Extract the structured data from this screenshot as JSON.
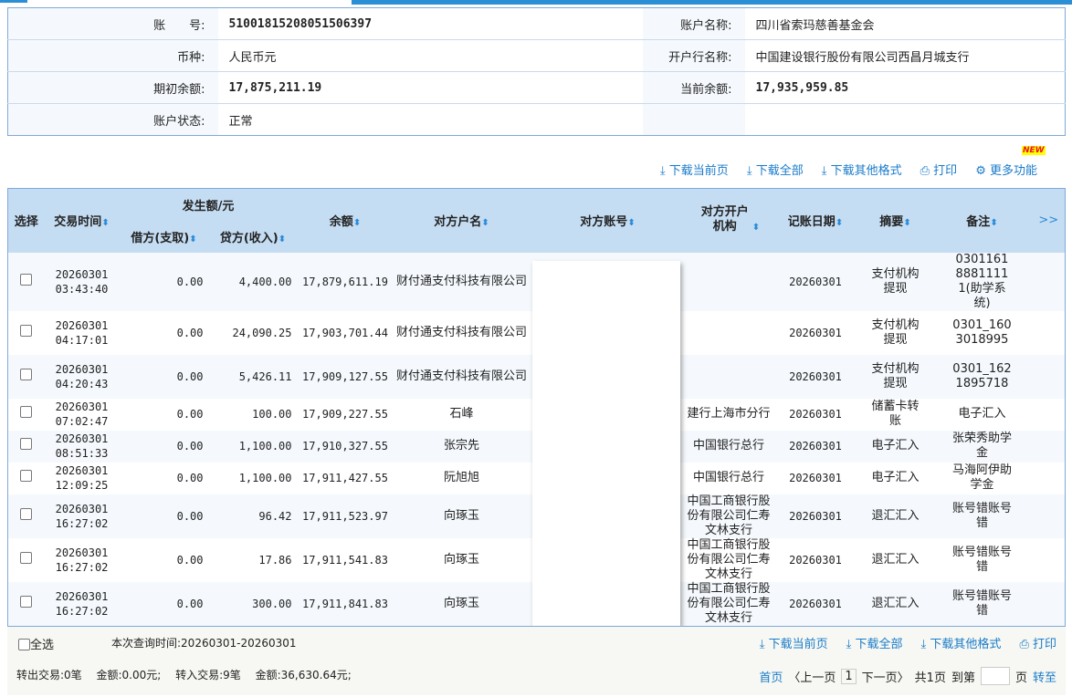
{
  "account": {
    "no_label": "账　　号:",
    "no": "51001815208051506397",
    "name_label": "账户名称:",
    "name": "四川省索玛慈善基金会",
    "currency_label": "币种:",
    "currency": "人民币元",
    "bank_label": "开户行名称:",
    "bank": "中国建设银行股份有限公司西昌月城支行",
    "open_label": "期初余额:",
    "open": "17,875,211.19",
    "cur_label": "当前余额:",
    "cur": "17,935,959.85",
    "status_label": "账户状态:",
    "status": "正常"
  },
  "toolbar": {
    "new_badge": "NEW",
    "dl_page": "下载当前页",
    "dl_all": "下载全部",
    "dl_other": "下载其他格式",
    "print": "打印",
    "more": "更多功能"
  },
  "table": {
    "headers": {
      "select": "选择",
      "time": "交易时间",
      "amount": "发生额/元",
      "debit": "借方(支取)",
      "credit": "贷方(收入)",
      "balance": "余额",
      "cp_name": "对方户名",
      "cp_acct": "对方账号",
      "cp_bank": "对方开户机构",
      "book_date": "记账日期",
      "summary": "摘要",
      "remark": "备注",
      "more": ">>"
    },
    "rows": [
      {
        "date": "20260301",
        "time": "03:43:40",
        "debit": "0.00",
        "credit": "4,400.00",
        "balance": "17,879,611.19",
        "name": "财付通支付科技有限公司",
        "bank": "",
        "book": "20260301",
        "summary": "支付机构提现",
        "remark": "030116188811111(助学系统)"
      },
      {
        "date": "20260301",
        "time": "04:17:01",
        "debit": "0.00",
        "credit": "24,090.25",
        "balance": "17,903,701.44",
        "name": "财付通支付科技有限公司",
        "bank": "",
        "book": "20260301",
        "summary": "支付机构提现",
        "remark": "0301_1603018995"
      },
      {
        "date": "20260301",
        "time": "04:20:43",
        "debit": "0.00",
        "credit": "5,426.11",
        "balance": "17,909,127.55",
        "name": "财付通支付科技有限公司",
        "bank": "",
        "book": "20260301",
        "summary": "支付机构提现",
        "remark": "0301_1621895718"
      },
      {
        "date": "20260301",
        "time": "07:02:47",
        "debit": "0.00",
        "credit": "100.00",
        "balance": "17,909,227.55",
        "name": "石峰",
        "bank": "建行上海市分行",
        "book": "20260301",
        "summary": "储蓄卡转账",
        "remark": "电子汇入"
      },
      {
        "date": "20260301",
        "time": "08:51:33",
        "debit": "0.00",
        "credit": "1,100.00",
        "balance": "17,910,327.55",
        "name": "张宗先",
        "bank": "中国银行总行",
        "book": "20260301",
        "summary": "电子汇入",
        "remark": "张荣秀助学金"
      },
      {
        "date": "20260301",
        "time": "12:09:25",
        "debit": "0.00",
        "credit": "1,100.00",
        "balance": "17,911,427.55",
        "name": "阮旭旭",
        "bank": "中国银行总行",
        "book": "20260301",
        "summary": "电子汇入",
        "remark": "马海阿伊助学金"
      },
      {
        "date": "20260301",
        "time": "16:27:02",
        "debit": "0.00",
        "credit": "96.42",
        "balance": "17,911,523.97",
        "name": "向琢玉",
        "bank": "中国工商银行股份有限公司仁寿文林支行",
        "book": "20260301",
        "summary": "退汇汇入",
        "remark": "账号错账号错"
      },
      {
        "date": "20260301",
        "time": "16:27:02",
        "debit": "0.00",
        "credit": "17.86",
        "balance": "17,911,541.83",
        "name": "向琢玉",
        "bank": "中国工商银行股份有限公司仁寿文林支行",
        "book": "20260301",
        "summary": "退汇汇入",
        "remark": "账号错账号错"
      },
      {
        "date": "20260301",
        "time": "16:27:02",
        "debit": "0.00",
        "credit": "300.00",
        "balance": "17,911,841.83",
        "name": "向琢玉",
        "bank": "中国工商银行股份有限公司仁寿文林支行",
        "book": "20260301",
        "summary": "退汇汇入",
        "remark": "账号错账号错"
      }
    ]
  },
  "footer": {
    "select_all": "全选",
    "query_time": "本次查询时间:20260301-20260301",
    "dl_page": "下载当前页",
    "dl_all": "下载全部",
    "dl_other": "下载其他格式",
    "print": "打印",
    "summary": "转出交易:0笔　 金额:0.00元;　 转入交易:9笔　 金额:36,630.64元;",
    "first": "首页",
    "prev": "〈上一页",
    "page": "1",
    "next": "下一页〉",
    "total": "共1页",
    "goto": "到第",
    "page_unit": "页",
    "go": "转至"
  }
}
